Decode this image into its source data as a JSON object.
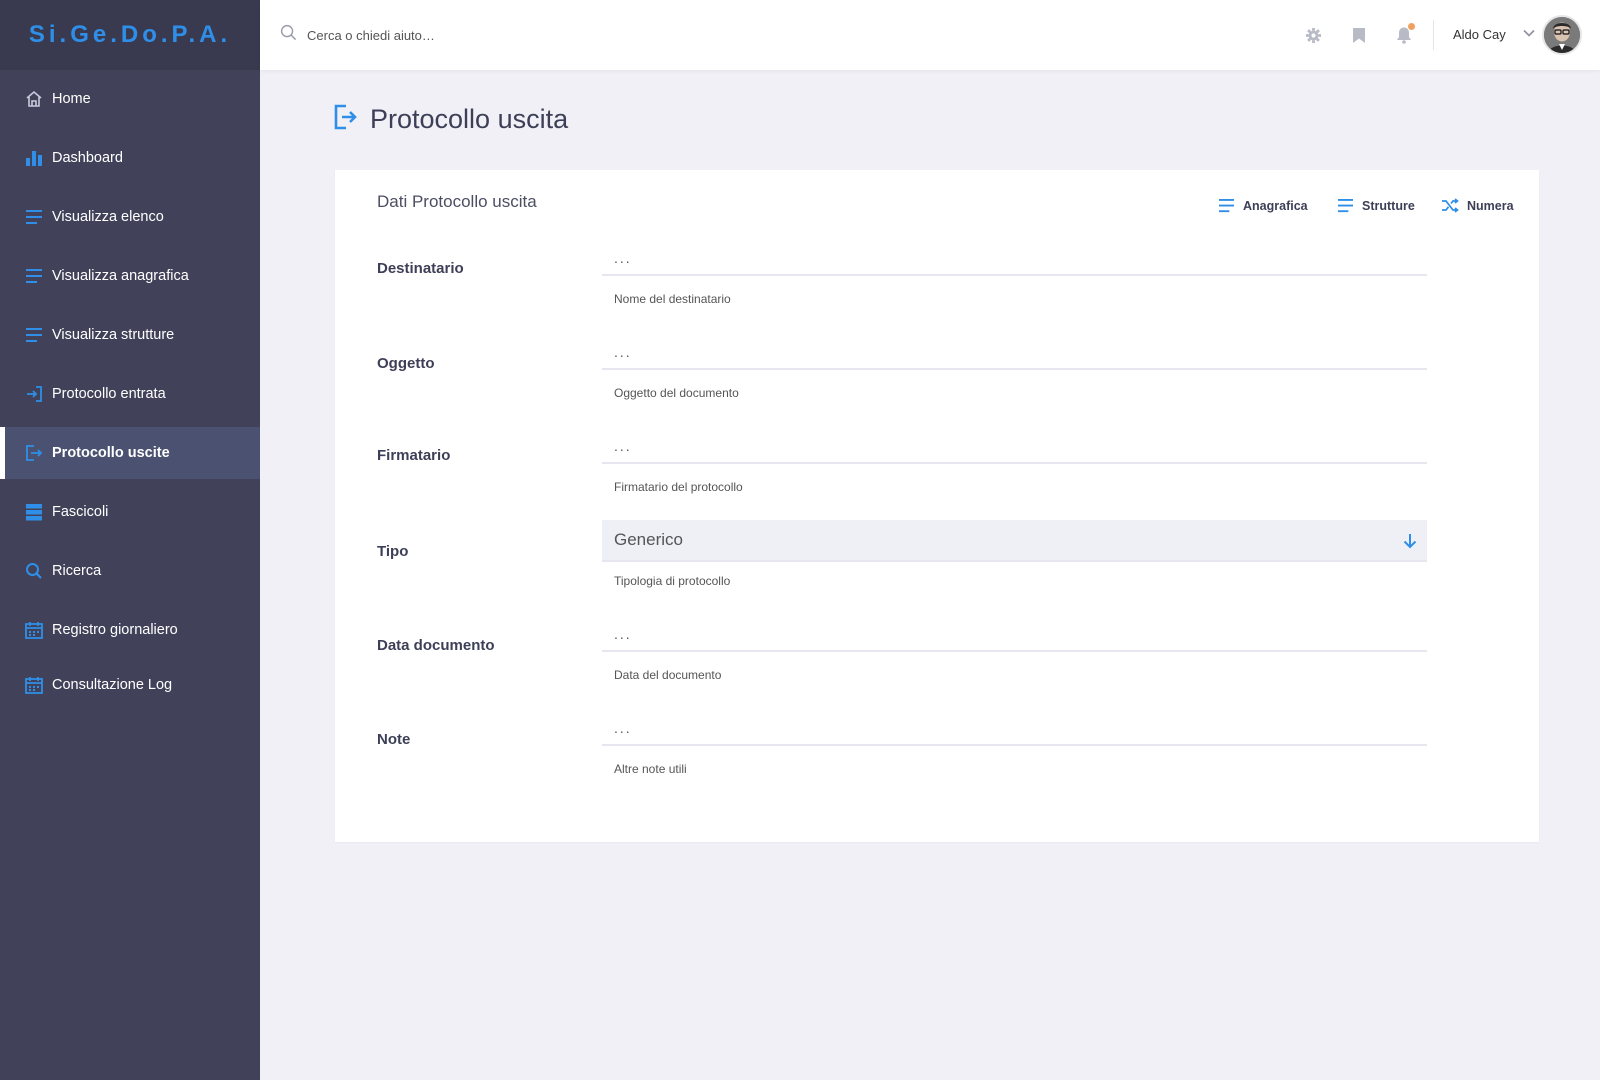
{
  "app": {
    "logo": "Si.Ge.Do.P.A."
  },
  "sidebar": {
    "items": [
      {
        "label": "Home",
        "icon": "home-icon"
      },
      {
        "label": "Dashboard",
        "icon": "bar-chart-icon"
      },
      {
        "label": "Visualizza elenco",
        "icon": "list-icon"
      },
      {
        "label": "Visualizza anagrafica",
        "icon": "list-icon"
      },
      {
        "label": "Visualizza strutture",
        "icon": "list-icon"
      },
      {
        "label": "Protocollo entrata",
        "icon": "sign-in-icon"
      },
      {
        "label": "Protocollo uscite",
        "icon": "sign-out-icon",
        "active": true
      },
      {
        "label": "Fascicoli",
        "icon": "server-icon"
      },
      {
        "label": "Ricerca",
        "icon": "search-icon"
      },
      {
        "label": "Registro giornaliero",
        "icon": "calendar-icon"
      },
      {
        "label": "Consultazione Log",
        "icon": "calendar-icon"
      }
    ]
  },
  "topbar": {
    "search_placeholder": "Cerca o chiedi aiuto…",
    "user_name": "Aldo Cay",
    "icons": [
      "gear-icon",
      "bookmark-icon",
      "bell-icon"
    ]
  },
  "page": {
    "title": "Protocollo uscita",
    "icon": "sign-out-icon"
  },
  "card": {
    "title": "Dati Protocollo uscita",
    "actions": [
      {
        "label": "Anagrafica",
        "icon": "list-icon"
      },
      {
        "label": "Strutture",
        "icon": "list-icon"
      },
      {
        "label": "Numera",
        "icon": "shuffle-icon"
      }
    ],
    "fields": [
      {
        "label": "Destinatario",
        "placeholder": "...",
        "help": "Nome del destinatario"
      },
      {
        "label": "Oggetto",
        "placeholder": "...",
        "help": "Oggetto del documento"
      },
      {
        "label": "Firmatario",
        "placeholder": "...",
        "help": "Firmatario del protocollo"
      },
      {
        "label": "Tipo",
        "value": "Generico",
        "help": "Tipologia di protocollo"
      },
      {
        "label": "Data documento",
        "placeholder": "...",
        "help": "Data del documento"
      },
      {
        "label": "Note",
        "placeholder": "...",
        "help": "Altre note utili"
      }
    ]
  },
  "colors": {
    "accent": "#2f8fe8",
    "sidebar_bg": "#414259",
    "sidebar_active": "#4b5271",
    "page_bg": "#f0f0f6"
  }
}
